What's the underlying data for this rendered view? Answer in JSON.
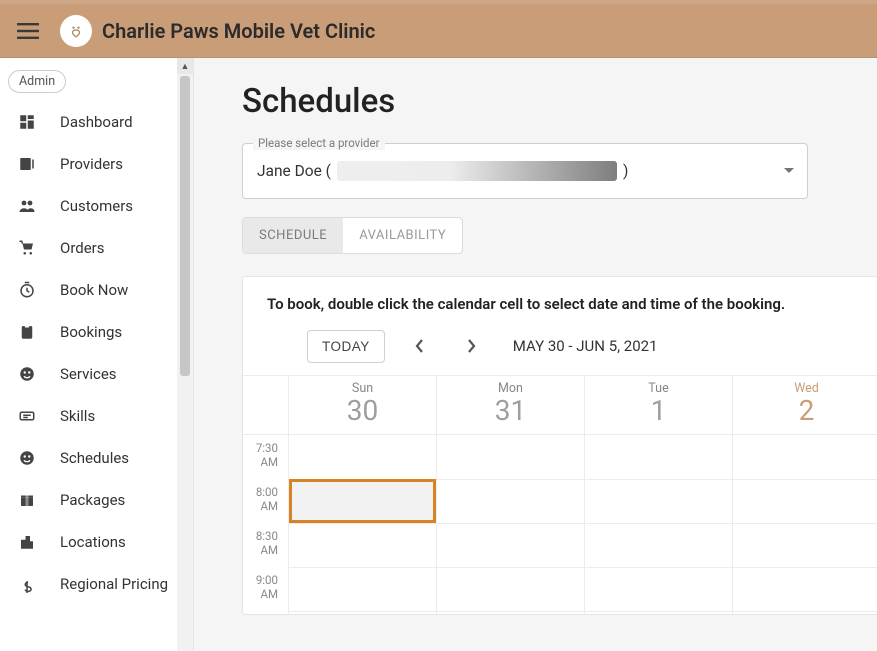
{
  "app": {
    "title": "Charlie Paws Mobile Vet Clinic"
  },
  "sidebar": {
    "role_chip": "Admin",
    "items": [
      {
        "icon": "dashboard-icon",
        "label": "Dashboard"
      },
      {
        "icon": "providers-icon",
        "label": "Providers"
      },
      {
        "icon": "customers-icon",
        "label": "Customers"
      },
      {
        "icon": "orders-icon",
        "label": "Orders"
      },
      {
        "icon": "booknow-icon",
        "label": "Book Now"
      },
      {
        "icon": "bookings-icon",
        "label": "Bookings"
      },
      {
        "icon": "services-icon",
        "label": "Services"
      },
      {
        "icon": "skills-icon",
        "label": "Skills"
      },
      {
        "icon": "schedules-icon",
        "label": "Schedules"
      },
      {
        "icon": "packages-icon",
        "label": "Packages"
      },
      {
        "icon": "locations-icon",
        "label": "Locations"
      },
      {
        "icon": "pricing-icon",
        "label": "Regional Pricing"
      }
    ]
  },
  "page": {
    "title": "Schedules",
    "selector": {
      "legend": "Please select a provider",
      "value_prefix": "Jane Doe (",
      "value_suffix": ")"
    },
    "tabs": {
      "schedule": "SCHEDULE",
      "availability": "AVAILABILITY"
    },
    "instruction": "To book, double click the calendar cell to select date and time of the booking.",
    "calendar": {
      "today_label": "TODAY",
      "range": "MAY 30 - JUN 5, 2021",
      "days": [
        {
          "name": "Sun",
          "date": "30"
        },
        {
          "name": "Mon",
          "date": "31"
        },
        {
          "name": "Tue",
          "date": "1"
        },
        {
          "name": "Wed",
          "date": "2"
        }
      ],
      "time_rows": [
        "7:30 AM",
        "8:00 AM",
        "8:30 AM",
        "9:00 AM"
      ],
      "selection": {
        "day": 0,
        "start": "8:00 AM",
        "end": "8:30 AM"
      }
    }
  },
  "colors": {
    "accent": "#c99d78",
    "selection_border": "#d98324"
  }
}
